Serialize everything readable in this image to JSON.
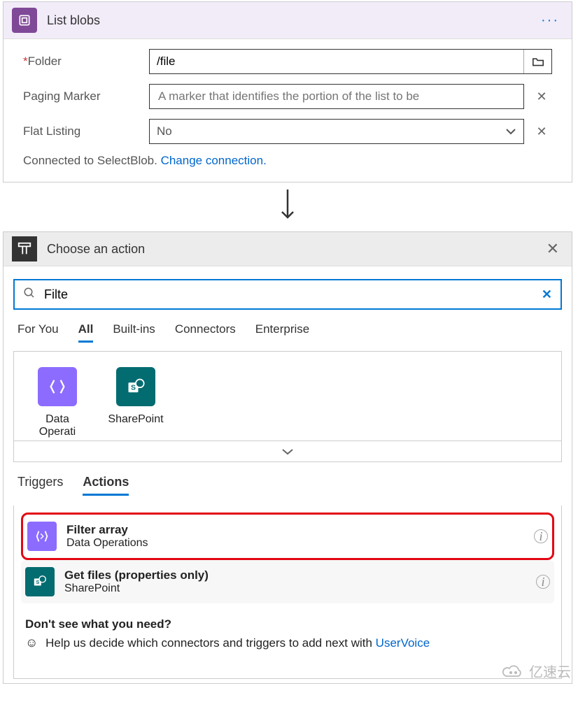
{
  "listBlobs": {
    "title": "List blobs",
    "folderLabel": "Folder",
    "folderValue": "/file",
    "pagingLabel": "Paging Marker",
    "pagingPlaceholder": "A marker that identifies the portion of the list to be",
    "flatLabel": "Flat Listing",
    "flatValue": "No",
    "connectedPrefix": "Connected to SelectBlob.  ",
    "changeLink": "Change connection."
  },
  "choose": {
    "title": "Choose an action",
    "searchValue": "Filte",
    "tabs": [
      "For You",
      "All",
      "Built-ins",
      "Connectors",
      "Enterprise"
    ],
    "activeTab": "All",
    "connectors": [
      {
        "name": "Data Operati",
        "key": "data-operations"
      },
      {
        "name": "SharePoint",
        "key": "sharepoint"
      }
    ],
    "subTabs": [
      "Triggers",
      "Actions"
    ],
    "activeSubTab": "Actions",
    "actions": [
      {
        "title": "Filter array",
        "sub": "Data Operations",
        "kind": "do",
        "highlight": true
      },
      {
        "title": "Get files (properties only)",
        "sub": "SharePoint",
        "kind": "sp",
        "highlight": false
      }
    ],
    "footer": {
      "question": "Don't see what you need?",
      "helpPrefix": "Help us decide which connectors and triggers to add next with ",
      "helpLink": "UserVoice"
    }
  },
  "watermark": "亿速云"
}
